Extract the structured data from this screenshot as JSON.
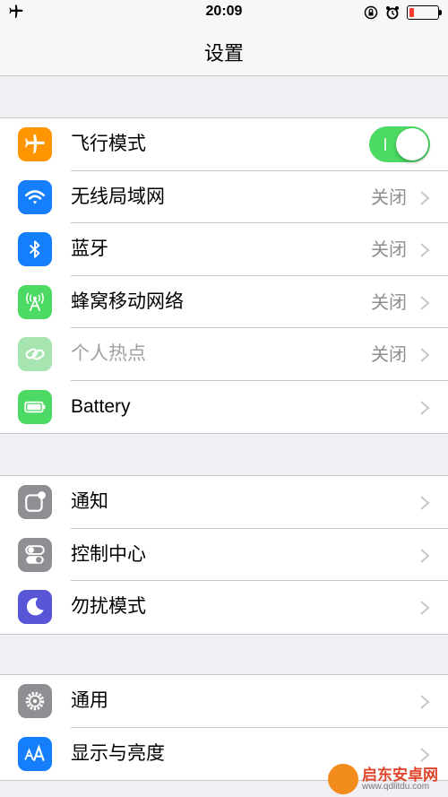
{
  "status_bar": {
    "time": "20:09",
    "left_icon": "airplane-icon",
    "right_icons": [
      "rotation-lock-icon",
      "alarm-icon",
      "battery-icon"
    ],
    "battery_level": 0.15,
    "battery_color": "#ff3b30"
  },
  "nav": {
    "title": "设置"
  },
  "groups": [
    {
      "items": [
        {
          "label": "飞行模式",
          "icon": "airplane-icon",
          "icon_color": "#ff9500",
          "control": "toggle",
          "toggle_on": true
        },
        {
          "label": "无线局域网",
          "icon": "wifi-icon",
          "icon_color": "#147efb",
          "value": "关闭"
        },
        {
          "label": "蓝牙",
          "icon": "bluetooth-icon",
          "icon_color": "#147efb",
          "value": "关闭"
        },
        {
          "label": "蜂窝移动网络",
          "icon": "cellular-antenna-icon",
          "icon_color": "#4cd964",
          "value": "关闭"
        },
        {
          "label": "个人热点",
          "icon": "hotspot-link-icon",
          "icon_color": "#a6e4b0",
          "value": "关闭",
          "disabled": true
        },
        {
          "label": "Battery",
          "icon": "battery-icon",
          "icon_color": "#4cd964"
        }
      ]
    },
    {
      "items": [
        {
          "label": "通知",
          "icon": "notifications-icon",
          "icon_color": "#8e8e93"
        },
        {
          "label": "控制中心",
          "icon": "control-center-icon",
          "icon_color": "#8e8e93"
        },
        {
          "label": "勿扰模式",
          "icon": "moon-icon",
          "icon_color": "#5856d6"
        }
      ]
    },
    {
      "items": [
        {
          "label": "通用",
          "icon": "gear-icon",
          "icon_color": "#8e8e93"
        },
        {
          "label": "显示与亮度",
          "icon": "text-size-icon",
          "icon_color": "#147efb"
        }
      ]
    }
  ],
  "watermark": {
    "title": "启东安卓网",
    "url": "www.qdlitdu.com",
    "logo_color": "#f28c1c"
  }
}
